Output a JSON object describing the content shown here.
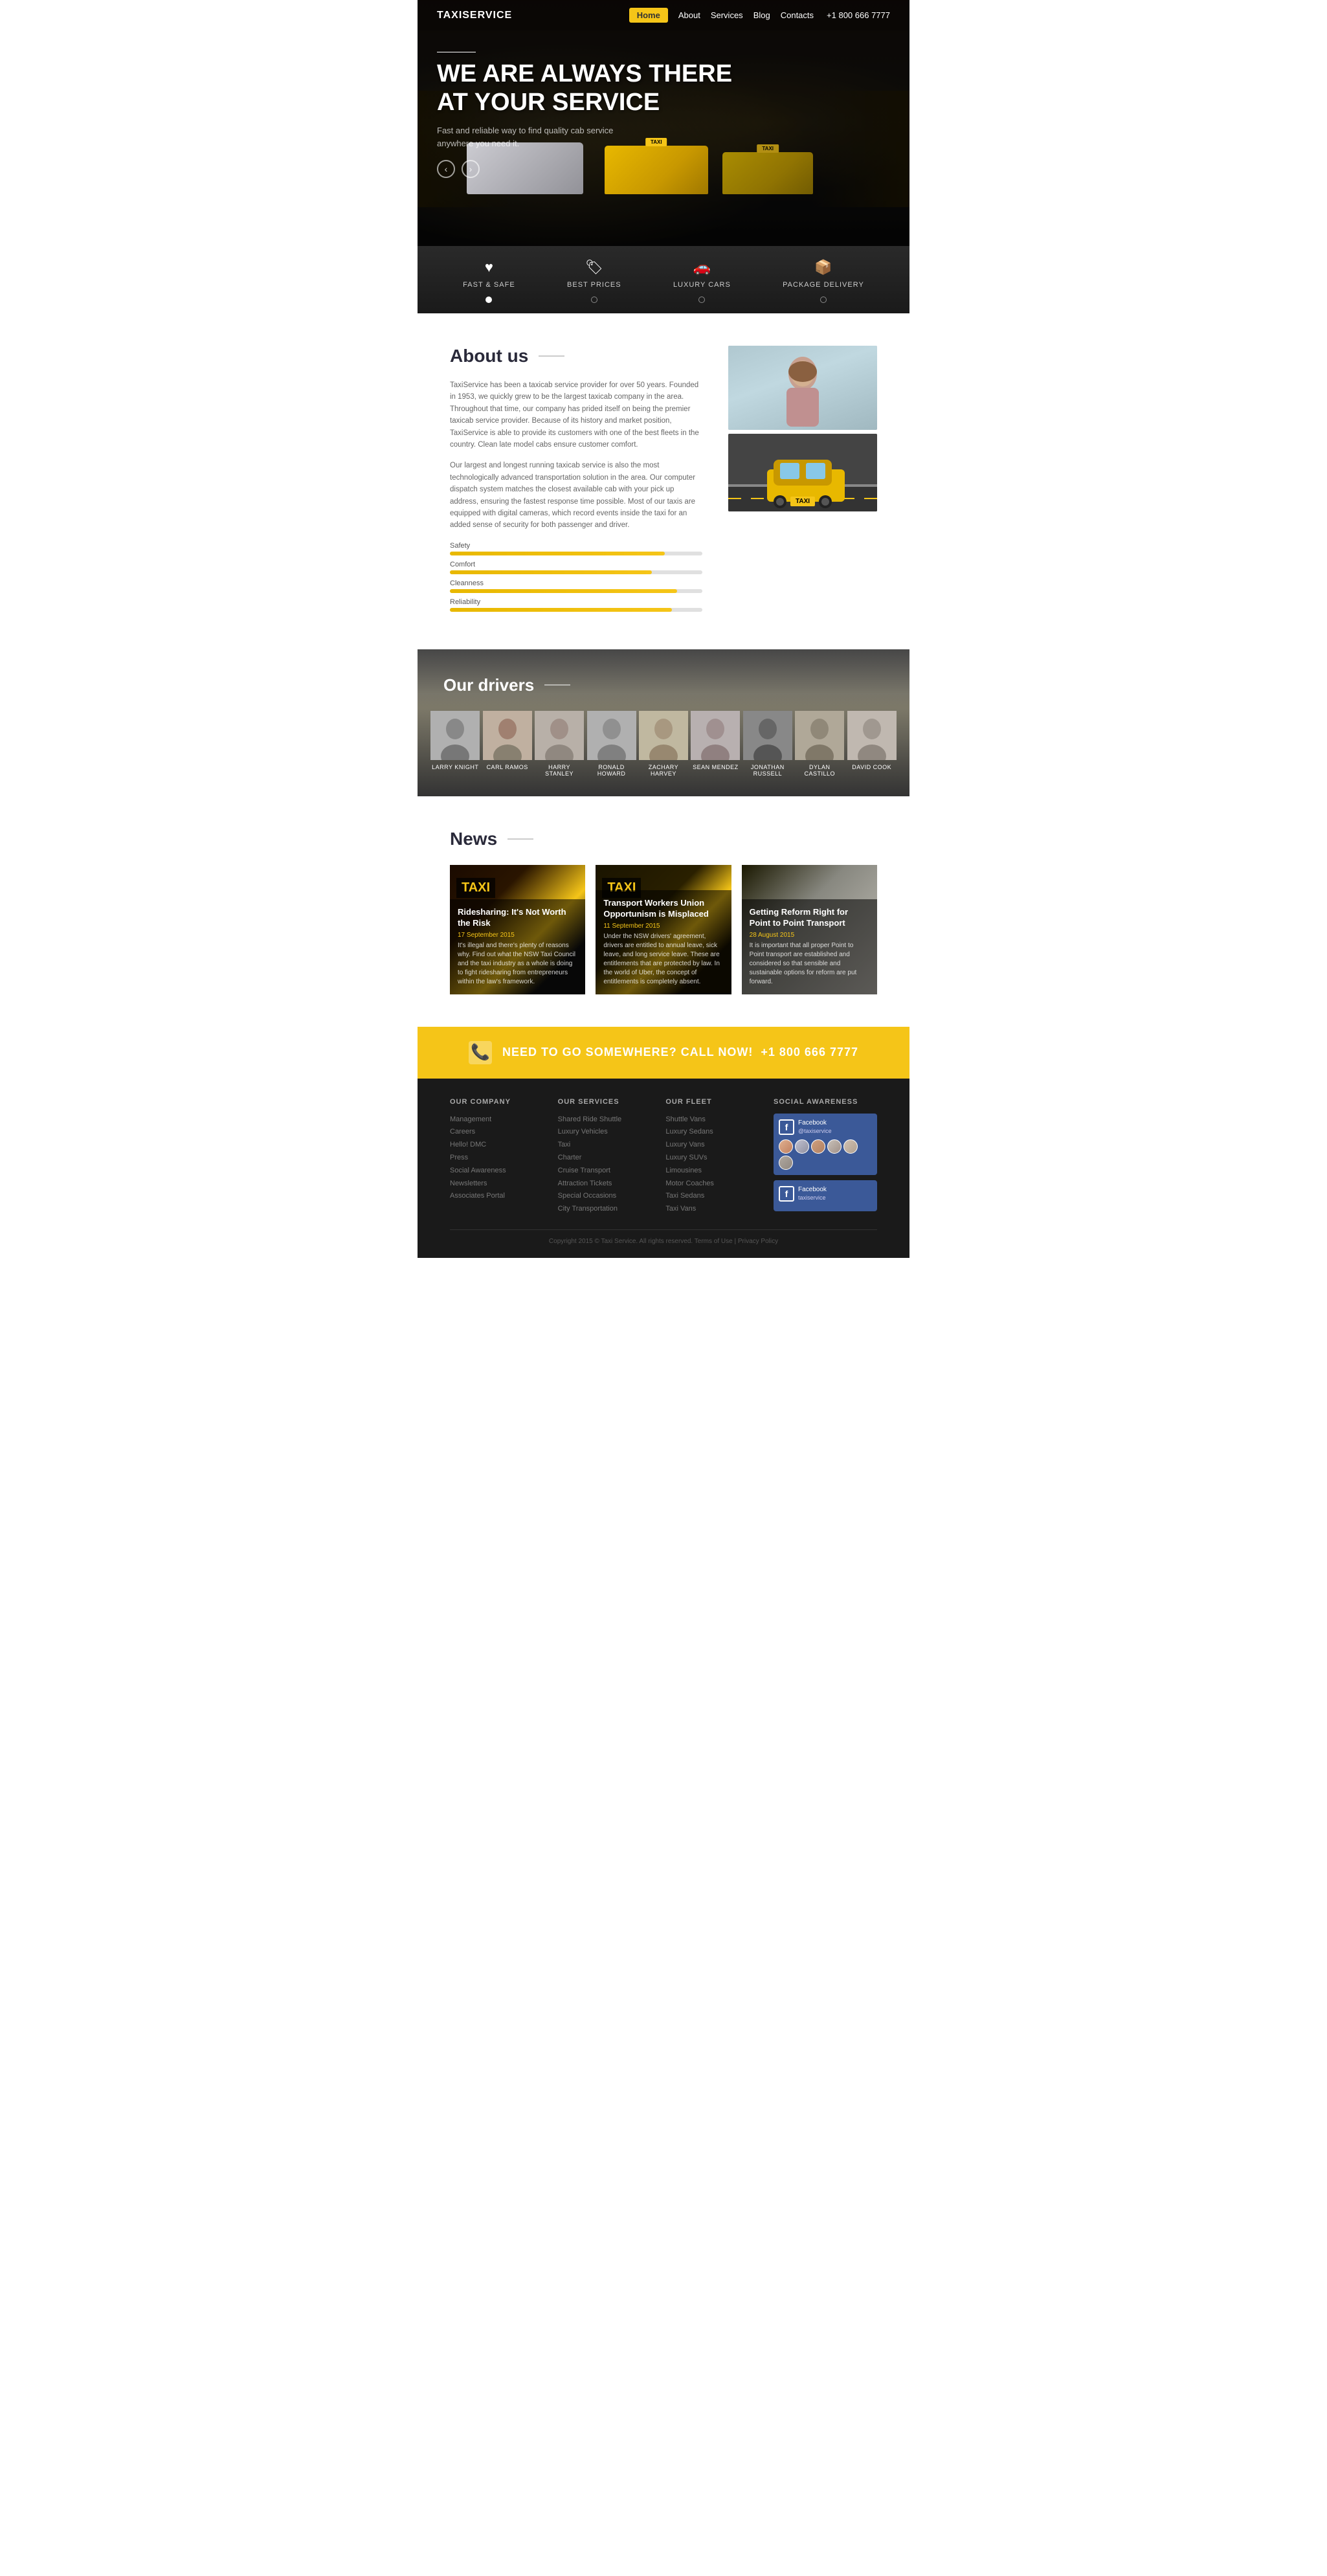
{
  "brand": {
    "name": "TAXISERVICE",
    "phone": "+1 800 666 7777"
  },
  "nav": {
    "home": "Home",
    "about": "About",
    "services": "Services",
    "blog": "Blog",
    "contacts": "Contacts"
  },
  "hero": {
    "line1": "WE ARE ALWAYS THERE",
    "line2": "AT YOUR SERVICE",
    "subtitle": "Fast and reliable way to find quality cab service anywhere you need it."
  },
  "features": [
    {
      "id": "fast-safe",
      "icon": "♥",
      "label": "FAST & SAFE",
      "active": true
    },
    {
      "id": "best-prices",
      "icon": "🏷",
      "label": "BEST PRICES",
      "active": false
    },
    {
      "id": "luxury-cars",
      "icon": "🚗",
      "label": "LUXURY CARS",
      "active": false
    },
    {
      "id": "package-delivery",
      "icon": "📦",
      "label": "PACKAGE DELIVERY",
      "active": false
    }
  ],
  "about": {
    "title": "About us",
    "text1": "TaxiService has been a taxicab service provider for over 50 years. Founded in 1953, we quickly grew to be the largest taxicab company in the area. Throughout that time, our company has prided itself on being the premier taxicab service provider. Because of its history and market position, TaxiService is able to provide its customers with one of the best fleets in the country. Clean late model cabs ensure customer comfort.",
    "text2": "Our largest and longest running taxicab service is also the most technologically advanced transportation solution in the area. Our computer dispatch system matches the closest available cab with your pick up address, ensuring the fastest response time possible. Most of our taxis are equipped with digital cameras, which record events inside the taxi for an added sense of security for both passenger and driver.",
    "skills": [
      {
        "label": "Safety",
        "width": "85"
      },
      {
        "label": "Comfort",
        "width": "80"
      },
      {
        "label": "Cleanness",
        "width": "90"
      },
      {
        "label": "Reliability",
        "width": "88"
      }
    ]
  },
  "drivers": {
    "title": "Our drivers",
    "people": [
      {
        "name": "LARRY KNIGHT"
      },
      {
        "name": "CARL RAMOS"
      },
      {
        "name": "HARRY STANLEY"
      },
      {
        "name": "RONALD HOWARD"
      },
      {
        "name": "ZACHARY HARVEY"
      },
      {
        "name": "SEAN MENDEZ"
      },
      {
        "name": "JONATHAN RUSSELL"
      },
      {
        "name": "DYLAN CASTILLO"
      },
      {
        "name": "DAVID COOK"
      }
    ]
  },
  "news": {
    "title": "News",
    "articles": [
      {
        "id": "article-1",
        "title": "Ridesharing: It's Not Worth the Risk",
        "date": "17 September 2015",
        "text": "It's illegal and there's plenty of reasons why. Find out what the NSW Taxi Council and the taxi industry as a whole is doing to fight ridesharing from entrepreneurs within the law's framework.",
        "img_class": "news-img-1"
      },
      {
        "id": "article-2",
        "title": "Transport Workers Union Opportunism is Misplaced",
        "date": "11 September 2015",
        "text": "Under the NSW drivers' agreement, drivers are entitled to annual leave, sick leave, and long service leave. These are entitlements that are protected by law. In the world of Uber, the concept of entitlements is completely absent.",
        "img_class": "news-img-2"
      },
      {
        "id": "article-3",
        "title": "Getting Reform Right for Point to Point Transport",
        "date": "28 August 2015",
        "text": "It is important that all proper Point to Point transport are established and considered so that sensible and sustainable options for reform are put forward.",
        "img_class": "news-img-3"
      }
    ]
  },
  "cta": {
    "text": "NEED TO GO SOMEWHERE? CALL NOW!",
    "phone": "+1 800 666 7777"
  },
  "footer": {
    "company_title": "OUR COMPANY",
    "company_links": [
      "Management",
      "Careers",
      "Hello! DMC",
      "Press",
      "Social Awareness",
      "Newsletters",
      "Associates Portal"
    ],
    "services_title": "OUR SERVICES",
    "services_links": [
      "Shared Ride Shuttle",
      "Luxury Vehicles",
      "Taxi",
      "Charter",
      "Cruise Transport",
      "Attraction Tickets",
      "Special Occasions",
      "City Transportation"
    ],
    "fleet_title": "OUR FLEET",
    "fleet_links": [
      "Shuttle Vans",
      "Luxury Sedans",
      "Luxury Vans",
      "Luxury SUVs",
      "Limousines",
      "Motor Coaches",
      "Taxi Sedans",
      "Taxi Vans"
    ],
    "social_title": "SOCIAL AWARENESS",
    "copyright": "Copyright 2015 © Taxi Service. All rights reserved. Terms of Use | Privacy Policy"
  }
}
